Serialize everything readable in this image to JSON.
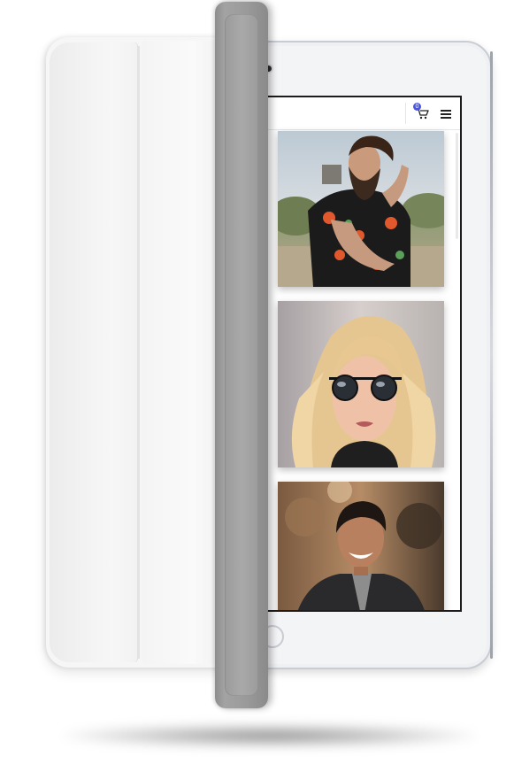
{
  "device": {
    "type": "tablet",
    "cover_color": "#f6f6f6",
    "flap_color": "#9a9a9a"
  },
  "header": {
    "cart_icon": "shopping-cart-icon",
    "cart_badge": "0",
    "menu_icon": "hamburger-menu-icon",
    "accent_color": "#4a55e0"
  },
  "feed": {
    "items": [
      {
        "name": "bearded-man-floral-shirt-photo"
      },
      {
        "name": "blonde-woman-sunglasses-photo"
      },
      {
        "name": "smiling-man-leather-jacket-photo"
      }
    ]
  }
}
